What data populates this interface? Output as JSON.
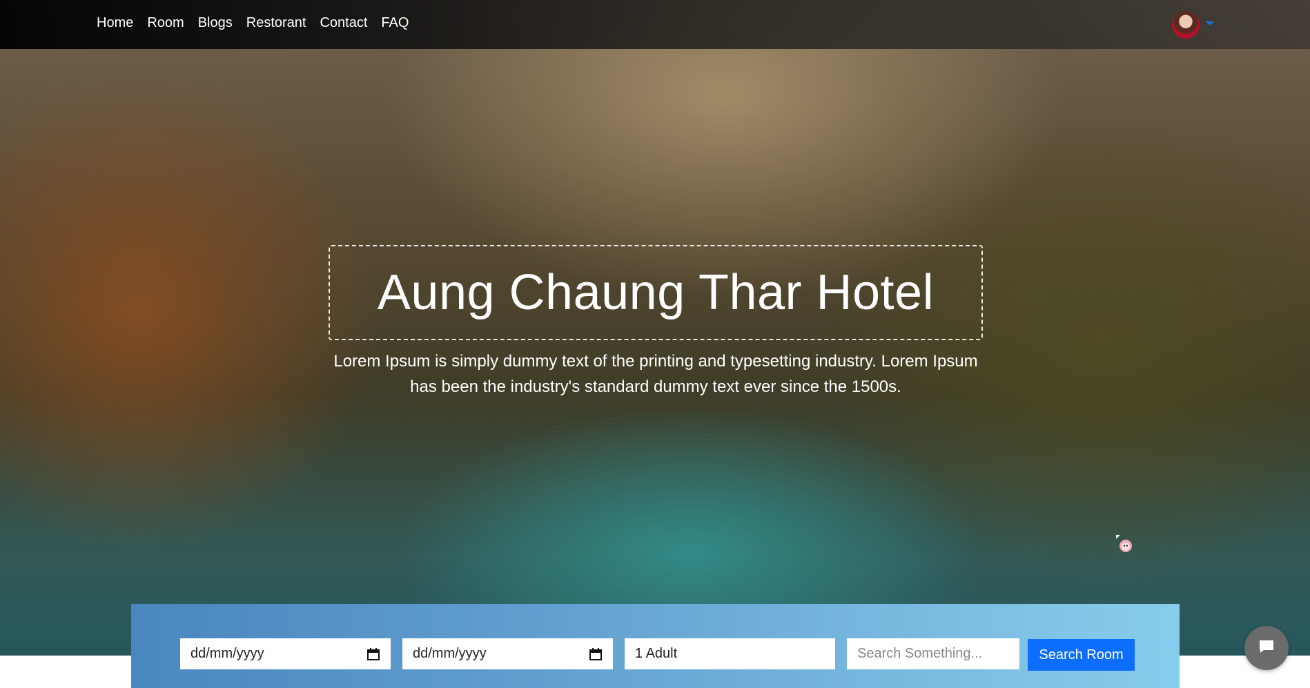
{
  "nav": {
    "links": [
      "Home",
      "Room",
      "Blogs",
      "Restorant",
      "Contact",
      "FAQ"
    ]
  },
  "hero": {
    "title": "Aung Chaung Thar Hotel",
    "subtitle": "Lorem Ipsum is simply dummy text of the printing and typesetting industry. Lorem Ipsum has been the industry's standard dummy text ever since the 1500s."
  },
  "search": {
    "checkin_placeholder": "dd/mm/yyyy",
    "checkout_placeholder": "dd/mm/yyyy",
    "guests_value": "1 Adult",
    "search_placeholder": "Search Something...",
    "button_label": "Search Room"
  },
  "colors": {
    "accent": "#0d6efd",
    "caret": "#1a73e8",
    "search_bar_start": "#4a86c0",
    "search_bar_end": "#86cdec"
  },
  "icons": {
    "avatar": "user-avatar",
    "caret": "caret-down-icon",
    "calendar": "calendar-icon",
    "chat": "chat-icon"
  }
}
